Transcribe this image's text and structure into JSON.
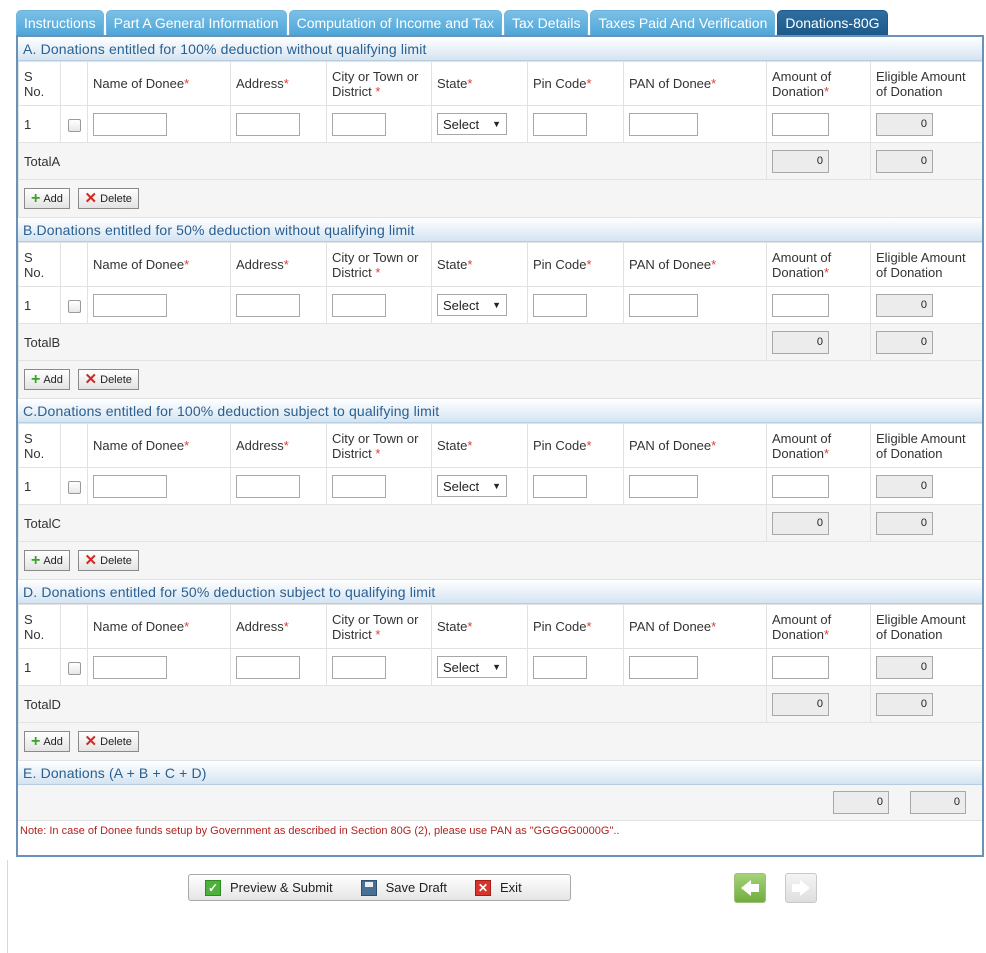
{
  "tabs": [
    {
      "label": "Instructions"
    },
    {
      "label": "Part A General Information"
    },
    {
      "label": "Computation of Income and Tax"
    },
    {
      "label": "Tax Details"
    },
    {
      "label": "Taxes Paid And Verification"
    },
    {
      "label": "Donations-80G"
    }
  ],
  "columns": {
    "sno_line1": "S",
    "sno_line2": "No.",
    "name": "Name of Donee",
    "address": "Address",
    "city_line1": "City or Town or",
    "city_line2": "District",
    "state": "State",
    "pin": "Pin Code",
    "pan": "PAN of Donee",
    "amount_line1": "Amount of",
    "amount_line2": "Donation",
    "eligible_line1": "Eligible Amount",
    "eligible_line2": "of Donation",
    "required_mark": "*"
  },
  "sections": [
    {
      "title": "A. Donations entitled for 100% deduction without qualifying limit",
      "row": {
        "sno": "1",
        "state": "Select",
        "eligible": "0"
      },
      "total_label": "TotalA",
      "total_amount": "0",
      "total_eligible": "0"
    },
    {
      "title": "B.Donations entitled for 50% deduction without qualifying limit",
      "row": {
        "sno": "1",
        "state": "Select",
        "eligible": "0"
      },
      "total_label": "TotalB",
      "total_amount": "0",
      "total_eligible": "0"
    },
    {
      "title": "C.Donations entitled for 100% deduction subject to qualifying limit",
      "row": {
        "sno": "1",
        "state": "Select",
        "eligible": "0"
      },
      "total_label": "TotalC",
      "total_amount": "0",
      "total_eligible": "0"
    },
    {
      "title": "D. Donations entitled for 50% deduction subject to qualifying limit",
      "row": {
        "sno": "1",
        "state": "Select",
        "eligible": "0"
      },
      "total_label": "TotalD",
      "total_amount": "0",
      "total_eligible": "0"
    }
  ],
  "buttons": {
    "add": "Add",
    "delete": "Delete"
  },
  "section_e": {
    "title": "E. Donations (A + B + C + D)",
    "amount": "0",
    "eligible": "0"
  },
  "note": "Note:    In case of Donee funds setup by Government as described in Section 80G (2), please use PAN as \"GGGGG0000G\"..",
  "actions": {
    "preview": "Preview & Submit",
    "save": "Save Draft",
    "exit": "Exit"
  },
  "icons": {
    "add": "plus-icon",
    "delete": "x-icon",
    "preview": "check-icon",
    "save": "floppy-disk-icon",
    "exit": "close-icon",
    "prev": "arrow-left-icon",
    "next": "arrow-right-icon"
  },
  "colors": {
    "tab": "#4fa6d8",
    "tab_active": "#1d5a8b",
    "section_title": "#2b5f8f",
    "required": "#d9403b",
    "note": "#b3231f"
  }
}
